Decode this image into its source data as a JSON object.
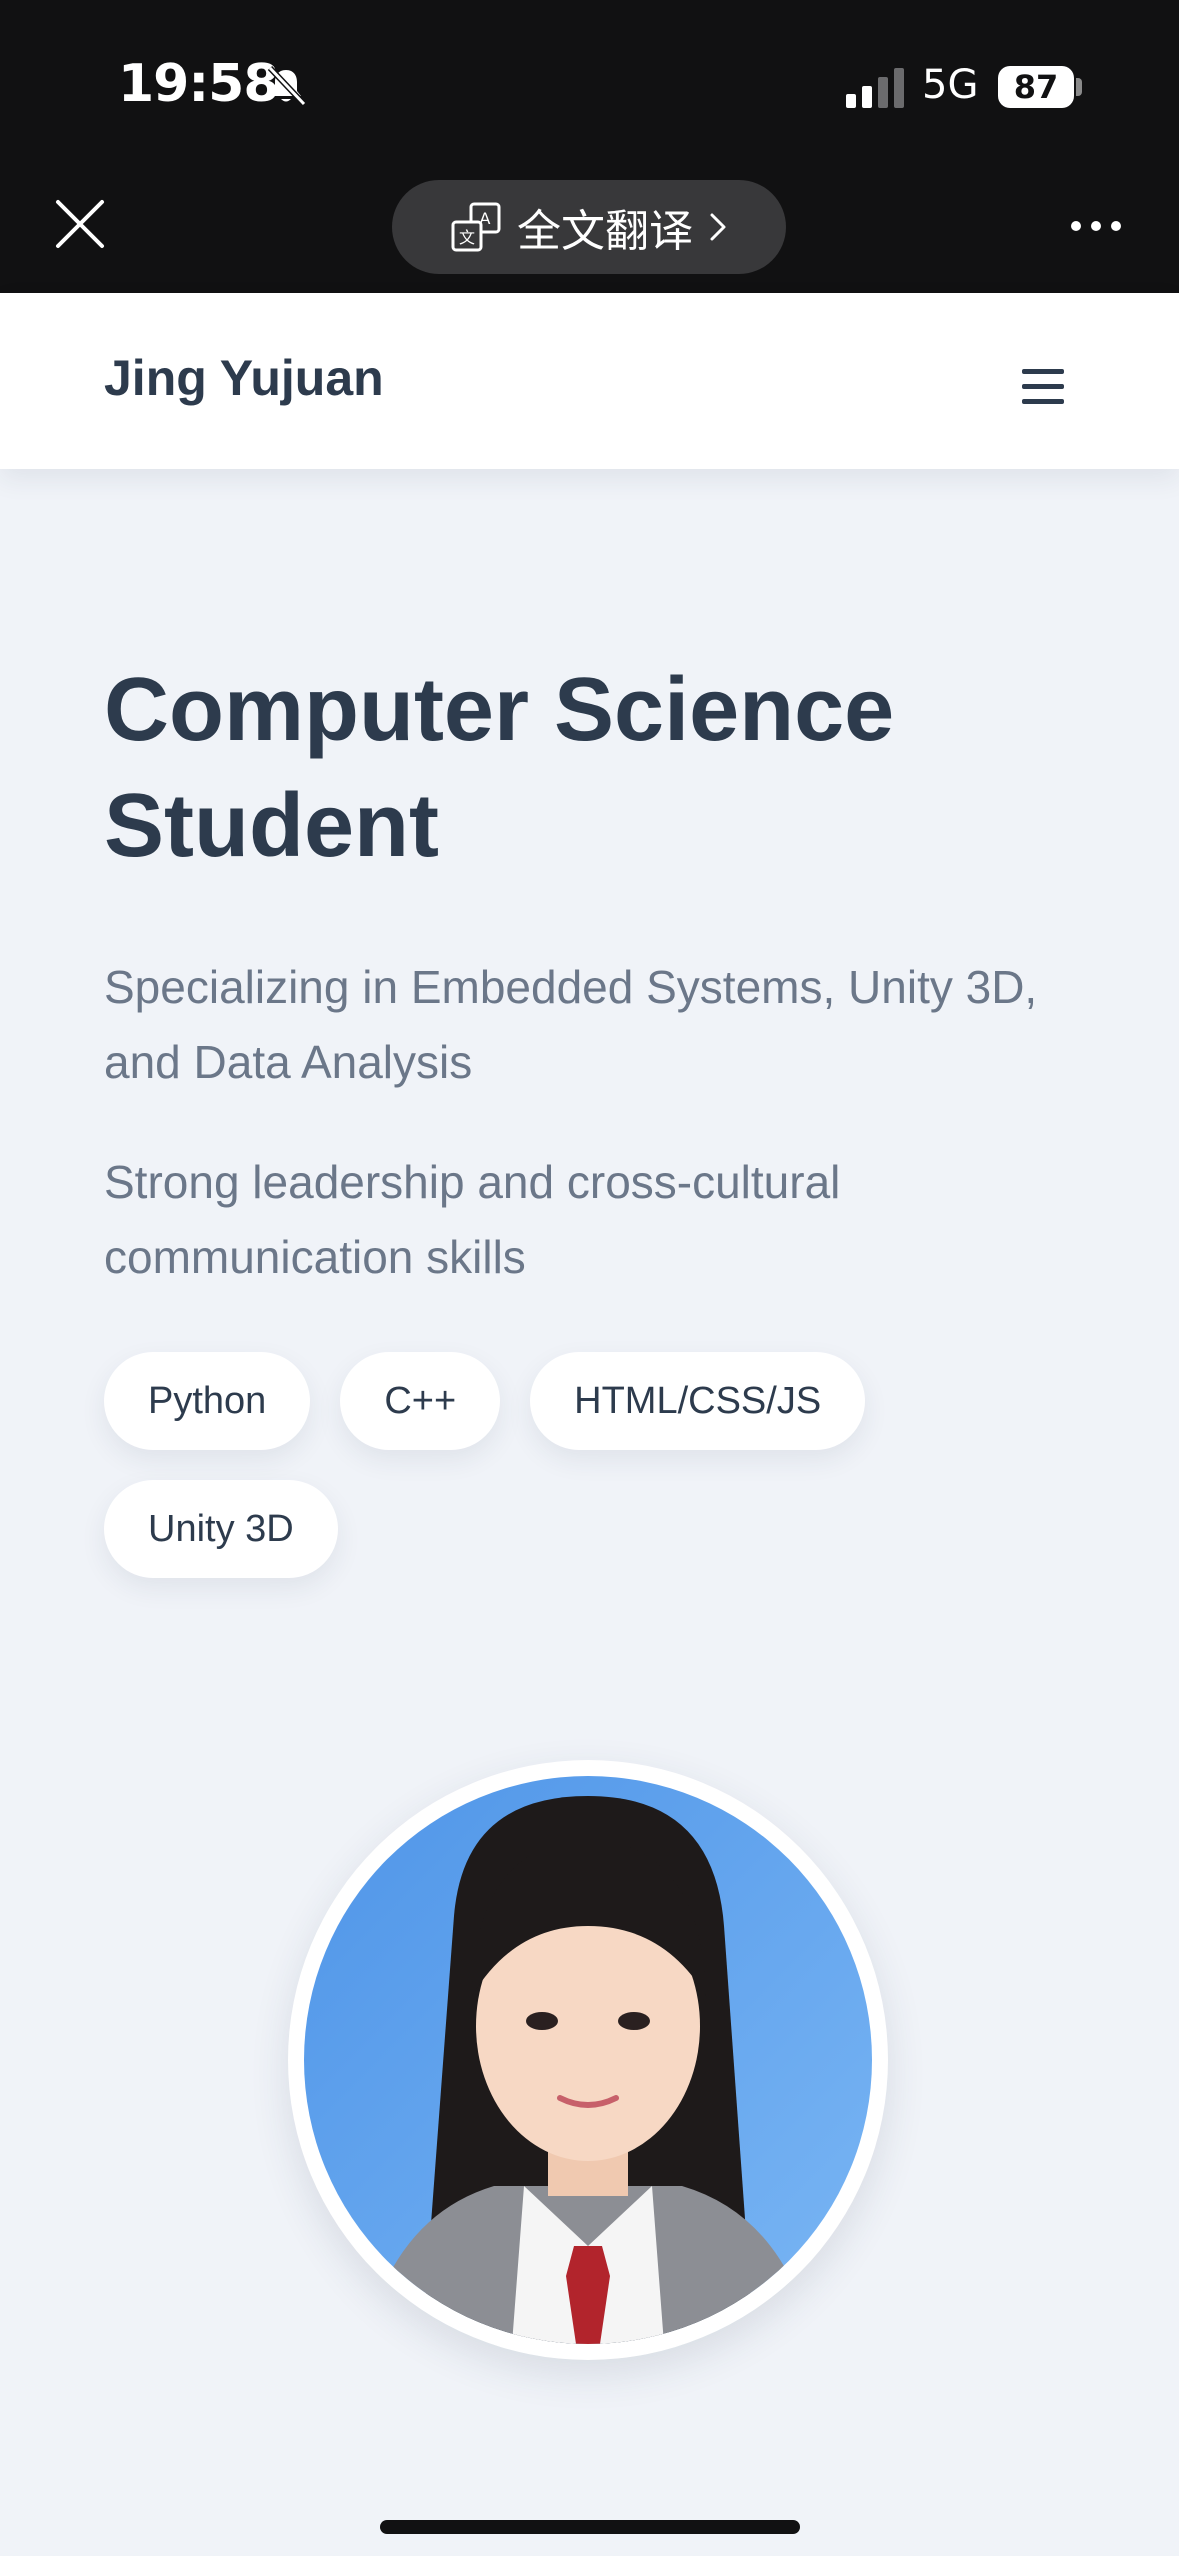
{
  "status_bar": {
    "time": "19:58",
    "network": "5G",
    "battery": "87",
    "icons": [
      "bell-off-icon",
      "signal-icon"
    ]
  },
  "browser": {
    "translate_label": "全文翻译",
    "icons": [
      "close-icon",
      "translate-icon",
      "chevron-right-icon",
      "more-icon"
    ]
  },
  "header": {
    "brand": "Jing Yujuan",
    "menu_icon": "hamburger-menu-icon"
  },
  "hero": {
    "title": "Computer Science Student",
    "subtitle": "Specializing in Embedded Systems, Unity 3D, and Data Analysis",
    "tagline": "Strong leadership and cross-cultural communication skills",
    "skills": [
      "Python",
      "C++",
      "HTML/CSS/JS",
      "Unity 3D"
    ]
  },
  "avatar": {
    "alt": "profile-photo"
  },
  "colors": {
    "page_bg": "#f0f3f8",
    "heading": "#2d3b4d",
    "muted_text": "#6b7789",
    "chrome_bg": "#111112",
    "pill_bg": "#ffffff"
  }
}
